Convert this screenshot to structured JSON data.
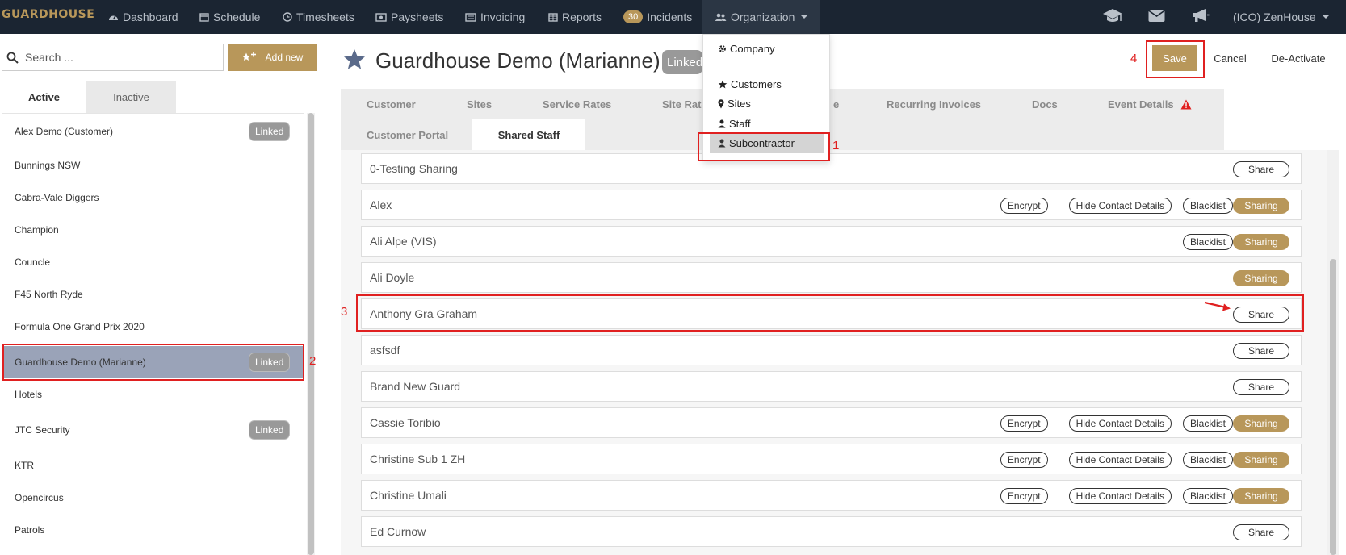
{
  "nav": {
    "logo": "GUARDHOUSE",
    "items": [
      {
        "label": "Dashboard",
        "icon": "dashboard-icon"
      },
      {
        "label": "Schedule",
        "icon": "calendar-icon"
      },
      {
        "label": "Timesheets",
        "icon": "clock-icon"
      },
      {
        "label": "Paysheets",
        "icon": "money-icon"
      },
      {
        "label": "Invoicing",
        "icon": "invoice-icon"
      },
      {
        "label": "Reports",
        "icon": "table-icon"
      },
      {
        "label": "Incidents",
        "badge": "30"
      },
      {
        "label": "Organization",
        "icon": "users-icon"
      }
    ],
    "right_icons": [
      "graduation-cap-icon",
      "envelope-icon",
      "bullhorn-icon"
    ],
    "account": "(ICO) ZenHouse"
  },
  "dropdown": {
    "items": [
      {
        "label": "Company",
        "icon": "gear-icon"
      },
      {
        "label": "Customers",
        "icon": "star-icon"
      },
      {
        "label": "Sites",
        "icon": "map-marker-icon"
      },
      {
        "label": "Staff",
        "icon": "user-icon"
      },
      {
        "label": "Subcontractor",
        "icon": "user-icon"
      }
    ]
  },
  "left": {
    "search_placeholder": "Search ...",
    "add_new": "Add new",
    "tabs": [
      "Active",
      "Inactive"
    ],
    "items": [
      {
        "name": "Alex Demo (Customer)",
        "badge": "Linked"
      },
      {
        "name": "Bunnings NSW"
      },
      {
        "name": "Cabra-Vale Diggers"
      },
      {
        "name": "Champion"
      },
      {
        "name": "Councle"
      },
      {
        "name": "F45 North Ryde"
      },
      {
        "name": "Formula One Grand Prix 2020"
      },
      {
        "name": "Guardhouse Demo (Marianne)",
        "badge": "Linked",
        "selected": true
      },
      {
        "name": "Hotels"
      },
      {
        "name": "JTC Security",
        "badge": "Linked"
      },
      {
        "name": "KTR"
      },
      {
        "name": "Opencircus"
      },
      {
        "name": "Patrols"
      }
    ]
  },
  "header": {
    "title": "Guardhouse Demo (Marianne)",
    "linked": "Linked",
    "save": "Save",
    "cancel": "Cancel",
    "deactivate": "De-Activate"
  },
  "tabs": [
    "Customer",
    "Sites",
    "Service Rates",
    "Site Rates",
    "e",
    "Recurring Invoices",
    "Docs",
    "Event Details",
    "Customer Portal",
    "Shared Staff"
  ],
  "staff": [
    {
      "name": "0-Testing Sharing",
      "actions": [
        "Share"
      ]
    },
    {
      "name": "Alex",
      "actions": [
        "Encrypt",
        "Hide Contact Details",
        "Blacklist",
        "Sharing"
      ]
    },
    {
      "name": "Ali Alpe (VIS)",
      "actions": [
        "Blacklist",
        "Sharing"
      ]
    },
    {
      "name": "Ali Doyle",
      "actions": [
        "Sharing"
      ]
    },
    {
      "name": "Anthony Gra Graham",
      "actions": [
        "Share"
      ]
    },
    {
      "name": "asfsdf",
      "actions": [
        "Share"
      ]
    },
    {
      "name": "Brand New Guard",
      "actions": [
        "Share"
      ]
    },
    {
      "name": "Cassie Toribio",
      "actions": [
        "Encrypt",
        "Hide Contact Details",
        "Blacklist",
        "Sharing"
      ]
    },
    {
      "name": "Christine Sub 1 ZH",
      "actions": [
        "Encrypt",
        "Hide Contact Details",
        "Blacklist",
        "Sharing"
      ]
    },
    {
      "name": "Christine Umali",
      "actions": [
        "Encrypt",
        "Hide Contact Details",
        "Blacklist",
        "Sharing"
      ]
    },
    {
      "name": "Ed Curnow",
      "actions": [
        "Share"
      ]
    }
  ],
  "annotations": [
    "1",
    "2",
    "3",
    "4"
  ],
  "colors": {
    "accent": "#b8975a",
    "nav_bg": "#1b2532",
    "annotation": "#e02020"
  }
}
